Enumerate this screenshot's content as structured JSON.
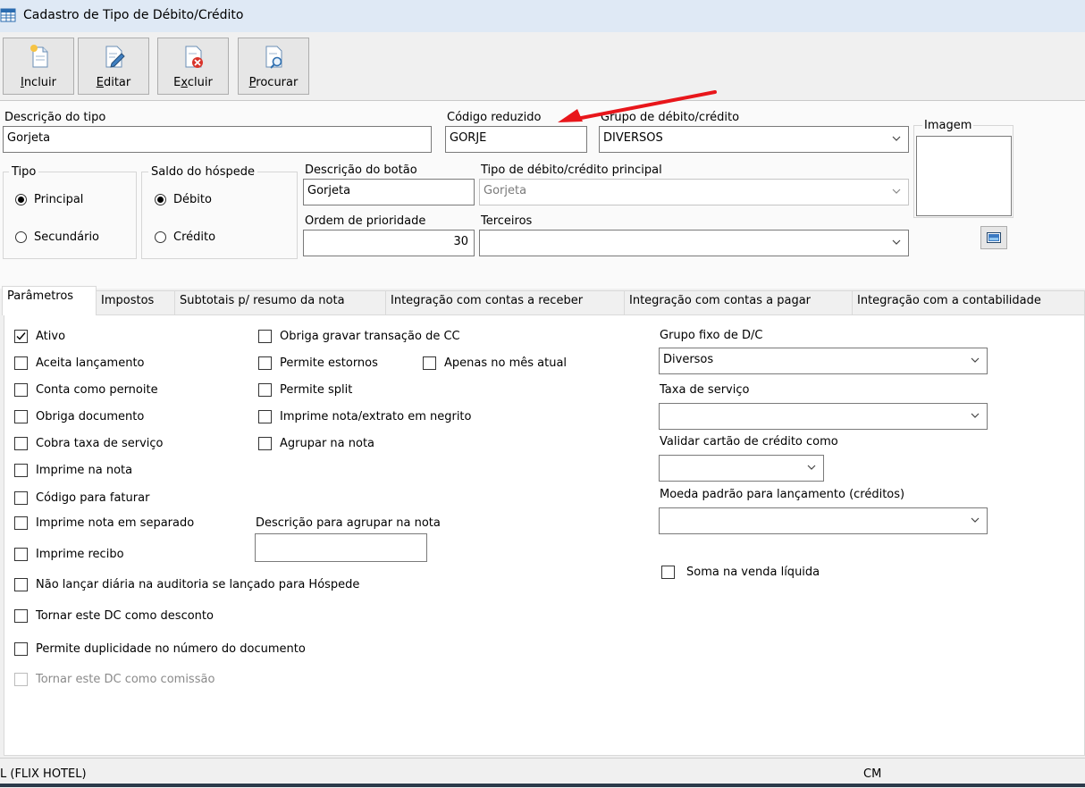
{
  "window": {
    "title": "Cadastro de Tipo de Débito/Crédito"
  },
  "toolbar": {
    "buttons": [
      {
        "key": "I",
        "rest": "ncluir",
        "icon": "new-document-icon"
      },
      {
        "key": "E",
        "rest": "ditar",
        "icon": "edit-document-icon"
      },
      {
        "key": "x",
        "pre": "E",
        "rest": "cluir",
        "icon": "delete-document-icon"
      },
      {
        "key": "P",
        "rest": "rocurar",
        "icon": "search-document-icon"
      }
    ]
  },
  "form": {
    "descricao_tipo": {
      "label": "Descrição do tipo",
      "value": "Gorjeta"
    },
    "codigo_reduzido": {
      "label": "Código reduzido",
      "value": "GORJE"
    },
    "grupo_dc": {
      "label": "Grupo de débito/crédito",
      "value": "DIVERSOS"
    },
    "imagem": {
      "label": "Imagem"
    },
    "tipo": {
      "label": "Tipo",
      "options": [
        "Principal",
        "Secundário"
      ],
      "selected": "Principal"
    },
    "saldo_hospede": {
      "label": "Saldo do hóspede",
      "options": [
        "Débito",
        "Crédito"
      ],
      "selected": "Débito"
    },
    "descricao_botao": {
      "label": "Descrição do botão",
      "value": "Gorjeta"
    },
    "tipo_principal": {
      "label": "Tipo de débito/crédito principal",
      "value": "Gorjeta"
    },
    "ordem_prioridade": {
      "label": "Ordem de prioridade",
      "value": "30"
    },
    "terceiros": {
      "label": "Terceiros",
      "value": ""
    }
  },
  "tabs": [
    "Parâmetros",
    "Impostos",
    "Subtotais p/ resumo da nota",
    "Integração com contas a receber",
    "Integração com contas a pagar",
    "Integração com a contabilidade"
  ],
  "params": {
    "col1": [
      {
        "label": "Ativo",
        "checked": true
      },
      {
        "label": "Aceita lançamento",
        "checked": false
      },
      {
        "label": "Conta como pernoite",
        "checked": false
      },
      {
        "label": "Obriga documento",
        "checked": false
      },
      {
        "label": "Cobra taxa de serviço",
        "checked": false
      },
      {
        "label": "Imprime na nota",
        "checked": false
      },
      {
        "label": "Código para faturar",
        "checked": false
      },
      {
        "label": "Imprime nota em separado",
        "checked": false
      },
      {
        "label": "Imprime recibo",
        "checked": false
      },
      {
        "label": "Não lançar diária na auditoria se lançado para Hóspede",
        "checked": false
      },
      {
        "label": "Tornar este DC como desconto",
        "checked": false
      },
      {
        "label": "Permite duplicidade no número do documento",
        "checked": false
      },
      {
        "label": "Tornar este DC como comissão",
        "checked": false,
        "disabled": true
      }
    ],
    "col2": [
      {
        "label": "Obriga gravar transação de CC",
        "checked": false
      },
      {
        "label": "Permite estornos",
        "checked": false
      },
      {
        "label": "Apenas no mês atual",
        "checked": false
      },
      {
        "label": "Permite split",
        "checked": false
      },
      {
        "label": "Imprime nota/extrato em negrito",
        "checked": false
      },
      {
        "label": "Agrupar na nota",
        "checked": false
      }
    ],
    "descricao_agrupar": {
      "label": "Descrição para agrupar na nota",
      "value": ""
    },
    "grupo_fixo": {
      "label": "Grupo fixo de D/C",
      "value": "Diversos"
    },
    "taxa_servico": {
      "label": "Taxa de serviço",
      "value": ""
    },
    "validar_cartao": {
      "label": "Validar cartão de crédito como",
      "value": ""
    },
    "moeda_padrao": {
      "label": "Moeda padrão para lançamento (créditos)",
      "value": ""
    },
    "soma_venda": {
      "label": "Soma na venda líquida",
      "checked": false
    }
  },
  "status": {
    "left": "L (FLIX HOTEL)",
    "right": "CM"
  },
  "annotation": {
    "color": "#e8161b"
  }
}
